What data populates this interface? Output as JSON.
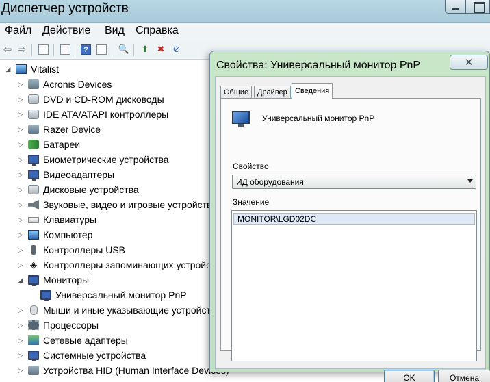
{
  "main_window": {
    "title": "Диспетчер устройств",
    "menu": [
      "Файл",
      "Действие",
      "Вид",
      "Справка"
    ]
  },
  "tree": {
    "root": "Vitalist",
    "categories": [
      {
        "label": "Acronis Devices",
        "icon": "device-icon"
      },
      {
        "label": "DVD и CD-ROM дисководы",
        "icon": "dvd-drive-icon"
      },
      {
        "label": "IDE ATA/ATAPI контроллеры",
        "icon": "ide-controller-icon"
      },
      {
        "label": "Razer Device",
        "icon": "device-icon"
      },
      {
        "label": "Батареи",
        "icon": "battery-icon"
      },
      {
        "label": "Биометрические устройства",
        "icon": "biometric-icon"
      },
      {
        "label": "Видеоадаптеры",
        "icon": "video-adapter-icon"
      },
      {
        "label": "Дисковые устройства",
        "icon": "disk-drive-icon"
      },
      {
        "label": "Звуковые, видео и игровые устройства",
        "icon": "speaker-icon"
      },
      {
        "label": "Клавиатуры",
        "icon": "keyboard-icon"
      },
      {
        "label": "Компьютер",
        "icon": "computer-icon"
      },
      {
        "label": "Контроллеры USB",
        "icon": "usb-icon"
      },
      {
        "label": "Контроллеры запоминающих устройств",
        "icon": "storage-controller-icon"
      },
      {
        "label": "Мониторы",
        "icon": "monitor-icon",
        "expanded": true
      },
      {
        "label": "Универсальный монитор PnP",
        "icon": "monitor-icon",
        "child": true
      },
      {
        "label": "Мыши и иные указывающие устройства",
        "icon": "mouse-icon"
      },
      {
        "label": "Процессоры",
        "icon": "cpu-icon"
      },
      {
        "label": "Сетевые адаптеры",
        "icon": "network-adapter-icon"
      },
      {
        "label": "Системные устройства",
        "icon": "system-device-icon"
      },
      {
        "label": "Устройства HID (Human Interface Devices)",
        "icon": "hid-icon"
      }
    ]
  },
  "dialog": {
    "title": "Свойства: Универсальный монитор PnP",
    "close_glyph": "✕",
    "tabs": [
      "Общие",
      "Драйвер",
      "Сведения"
    ],
    "active_tab": "Сведения",
    "device_name": "Универсальный монитор PnP",
    "property_label": "Свойство",
    "property_value": "ИД оборудования",
    "value_label": "Значение",
    "values": [
      "MONITOR\\LGD02DC"
    ],
    "ok_label": "OK",
    "cancel_label": "Отмена"
  }
}
